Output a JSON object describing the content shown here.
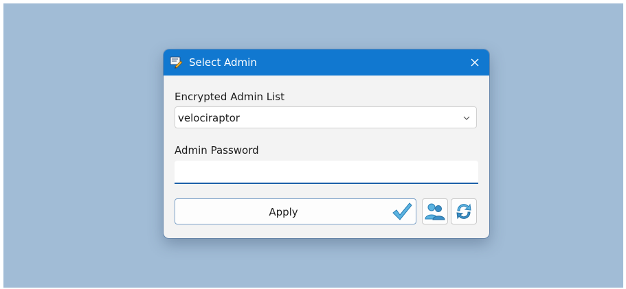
{
  "window": {
    "title": "Select Admin",
    "accent_color": "#1178d0",
    "icon": "edit-document-icon"
  },
  "admin_list": {
    "label": "Encrypted Admin List",
    "selected": "velociraptor"
  },
  "password": {
    "label": "Admin Password",
    "value": ""
  },
  "actions": {
    "apply_label": "Apply",
    "apply_icon": "checkmark-icon",
    "users_icon": "users-icon",
    "refresh_icon": "refresh-icon"
  }
}
